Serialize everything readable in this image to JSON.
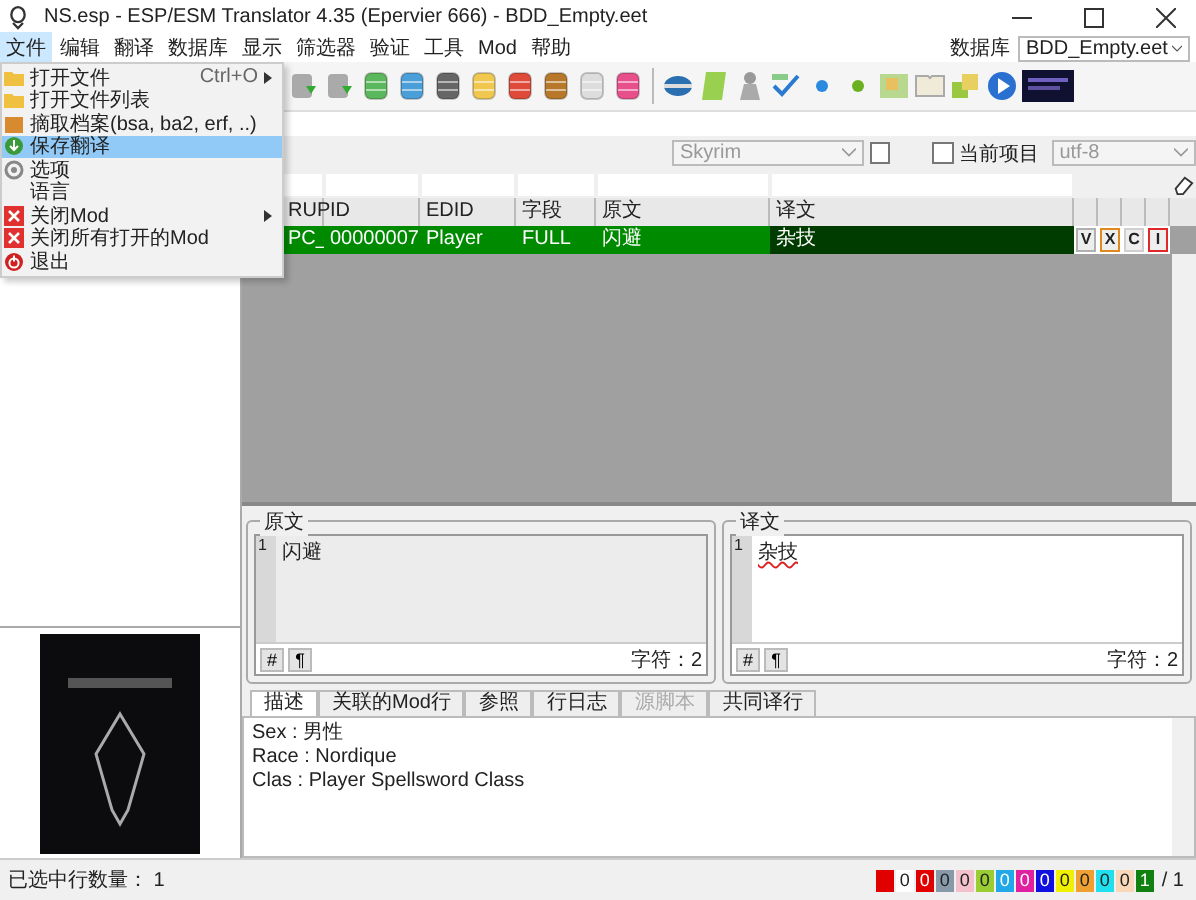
{
  "window": {
    "title": "NS.esp - ESP/ESM Translator 4.35 (Epervier 666) - BDD_Empty.eet"
  },
  "menu_bar": {
    "items": [
      {
        "label": "文件",
        "selected": true
      },
      {
        "label": "编辑",
        "selected": false
      },
      {
        "label": "翻译",
        "selected": false
      },
      {
        "label": "数据库",
        "selected": false
      },
      {
        "label": "显示",
        "selected": false
      },
      {
        "label": "筛选器",
        "selected": false
      },
      {
        "label": "验证",
        "selected": false
      },
      {
        "label": "工具",
        "selected": false
      },
      {
        "label": "Mod",
        "selected": false
      },
      {
        "label": "帮助",
        "selected": false
      }
    ],
    "database_label": "数据库",
    "database_value": "BDD_Empty.eet"
  },
  "file_menu": [
    {
      "label": "打开文件",
      "shortcut": "Ctrl+O",
      "submenu": true,
      "selected": false
    },
    {
      "label": "打开文件列表",
      "submenu": false,
      "selected": false
    },
    {
      "label": "摘取档案(bsa, ba2, erf, ..)",
      "submenu": false,
      "selected": false
    },
    {
      "label": "保存翻译",
      "submenu": false,
      "selected": true
    },
    {
      "label": "选项",
      "submenu": false,
      "selected": false
    },
    {
      "label": "语言",
      "submenu": false,
      "selected": false
    },
    {
      "label": "关闭Mod",
      "submenu": true,
      "selected": false
    },
    {
      "label": "关闭所有打开的Mod",
      "submenu": false,
      "selected": false
    },
    {
      "label": "退出",
      "submenu": false,
      "selected": false
    }
  ],
  "options_bar": {
    "game": "Skyrim",
    "game_disabled": true,
    "checkbox": {
      "checked": false
    },
    "current_item": {
      "label": "当前项目",
      "checked": false
    },
    "encoding": "utf-8"
  },
  "grid": {
    "columns": [
      "RUP",
      "ID",
      "EDID",
      "字段",
      "原文",
      "译文"
    ],
    "rows": [
      {
        "cells": [
          "PC_",
          "00000007",
          "Player",
          "FULL",
          "闪避",
          "杂技"
        ],
        "translated": true,
        "flags": [
          {
            "label": "V",
            "color": "#b0b0b0"
          },
          {
            "label": "X",
            "color": "#e08a1e"
          },
          {
            "label": "C",
            "color": "#d0d0d0"
          },
          {
            "label": "I",
            "color": "#e02828"
          }
        ]
      }
    ]
  },
  "editors": [
    {
      "title": "原文",
      "line_number": "1",
      "text": "闪避",
      "readonly": true,
      "misspelled": false,
      "buttons": [
        "#",
        "¶"
      ],
      "char_count": "字符：2"
    },
    {
      "title": "译文",
      "line_number": "1",
      "text": "杂技",
      "readonly": false,
      "misspelled": true,
      "buttons": [
        "#",
        "¶"
      ],
      "char_count": "字符：2"
    }
  ],
  "tabs": [
    {
      "label": "描述",
      "selected": true,
      "disabled": false
    },
    {
      "label": "关联的Mod行",
      "selected": false,
      "disabled": false
    },
    {
      "label": "参照",
      "selected": false,
      "disabled": false
    },
    {
      "label": "行日志",
      "selected": false,
      "disabled": false
    },
    {
      "label": "源脚本",
      "selected": false,
      "disabled": true
    },
    {
      "label": "共同译行",
      "selected": false,
      "disabled": false
    }
  ],
  "description": [
    "Sex : 男性",
    "Race : Nordique",
    "Clas : Player Spellsword Class"
  ],
  "status_bar": {
    "selected_rows": "已选中行数量： 1",
    "counters": [
      {
        "color": "#e00000"
      },
      {
        "value": "0",
        "color": "#ffffff"
      },
      {
        "value": "0",
        "color": "#e00000"
      },
      {
        "value": "0",
        "color": "#8899aa"
      },
      {
        "value": "0",
        "color": "#f4c0cc"
      },
      {
        "value": "0",
        "color": "#9acd32"
      },
      {
        "value": "0",
        "color": "#20a8e8"
      },
      {
        "value": "0",
        "color": "#e020a0"
      },
      {
        "value": "0",
        "color": "#1010e0"
      },
      {
        "value": "0",
        "color": "#f0f000"
      },
      {
        "value": "0",
        "color": "#f0a030"
      },
      {
        "value": "0",
        "color": "#20e0f0"
      },
      {
        "value": "0",
        "color": "#f8d8b8"
      },
      {
        "value": "1",
        "color": "#108010"
      }
    ],
    "total": "/ 1"
  }
}
